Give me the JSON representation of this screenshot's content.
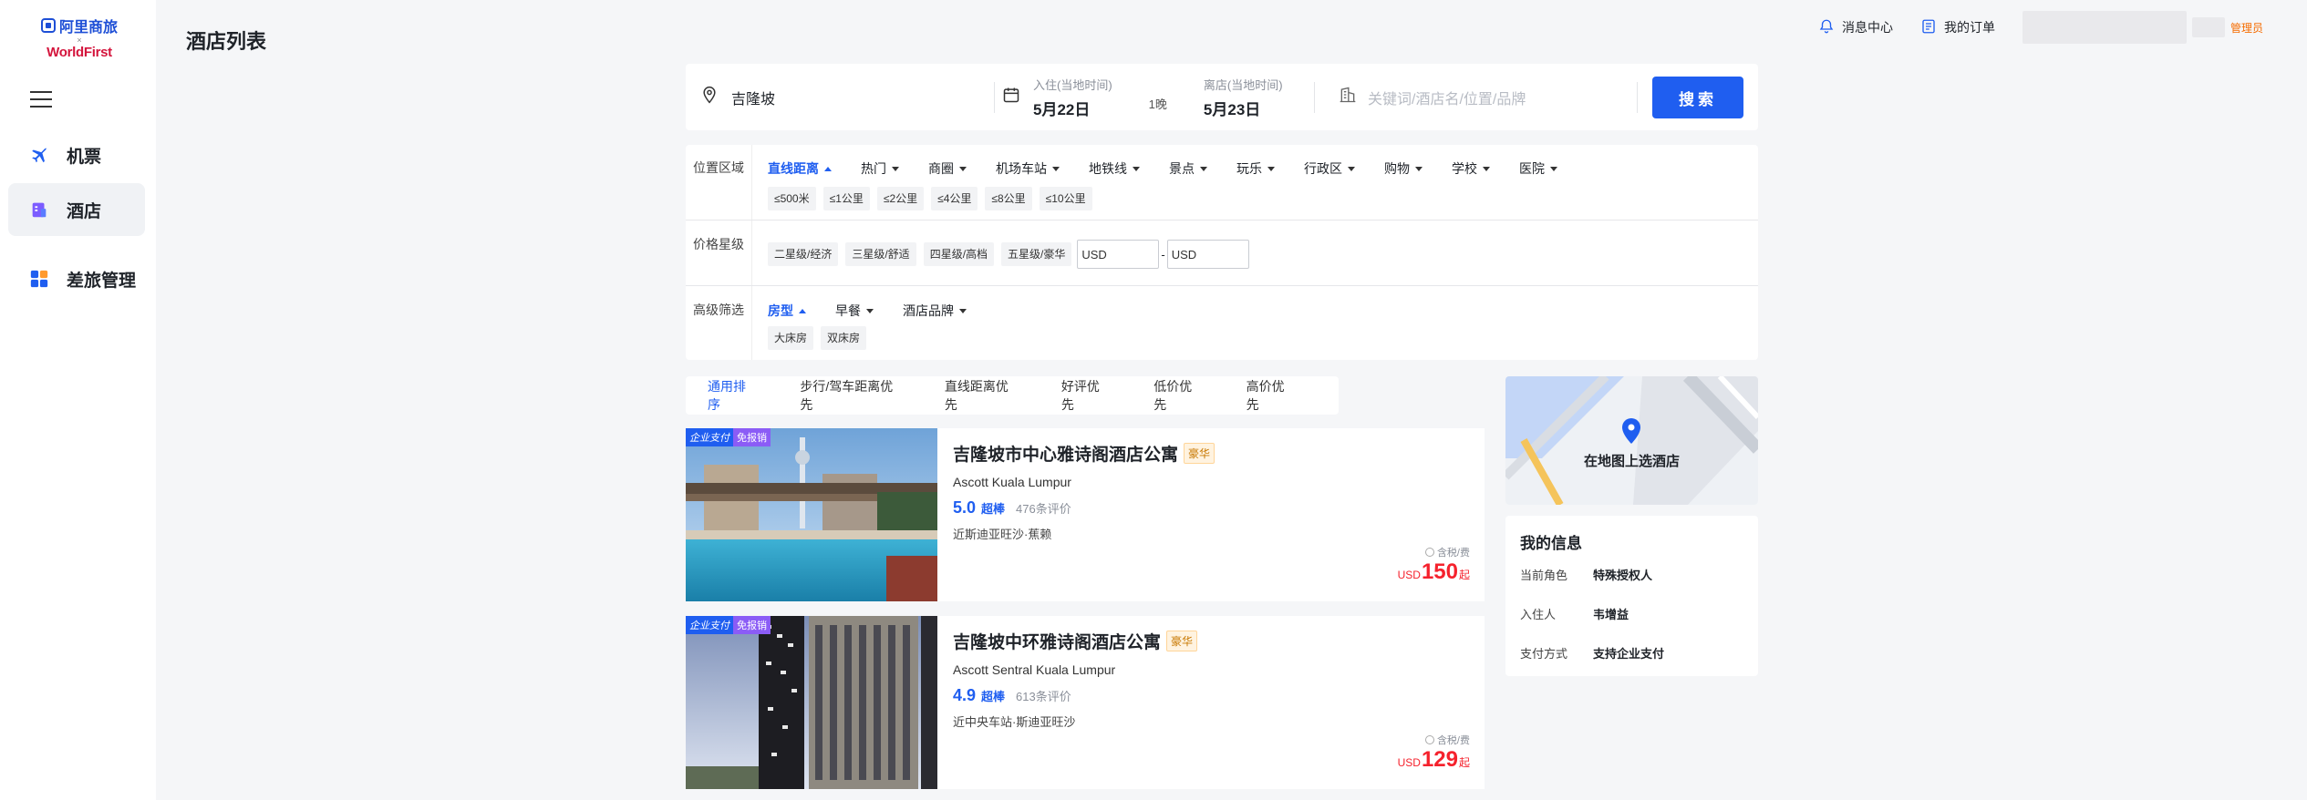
{
  "logo": {
    "top": "阿里商旅",
    "x": "×",
    "bottom": "WorldFirst"
  },
  "sidebar": {
    "items": [
      {
        "label": "机票",
        "icon": "airplane-icon"
      },
      {
        "label": "酒店",
        "icon": "hotel-icon"
      },
      {
        "label": "差旅管理",
        "icon": "apps-grid-icon"
      }
    ]
  },
  "page": {
    "title": "酒店列表"
  },
  "topbar": {
    "messages": "消息中心",
    "orders": "我的订单",
    "role_tag": "管理员"
  },
  "search": {
    "city": "吉隆坡",
    "checkin_label": "入住(当地时间)",
    "checkin_value": "5月22日",
    "nights": "1晚",
    "checkout_label": "离店(当地时间)",
    "checkout_value": "5月23日",
    "keyword_placeholder": "关键词/酒店名/位置/品牌",
    "button": "搜索"
  },
  "filters": {
    "location": {
      "label": "位置区域",
      "tabs": [
        "直线距离",
        "热门",
        "商圈",
        "机场车站",
        "地铁线",
        "景点",
        "玩乐",
        "行政区",
        "购物",
        "学校",
        "医院"
      ],
      "chips": [
        "≤500米",
        "≤1公里",
        "≤2公里",
        "≤4公里",
        "≤8公里",
        "≤10公里"
      ]
    },
    "price": {
      "label": "价格星级",
      "chips": [
        "二星级/经济",
        "三星级/舒适",
        "四星级/高档",
        "五星级/豪华"
      ],
      "min": "USD",
      "max": "USD",
      "dash": "-"
    },
    "advanced": {
      "label": "高级筛选",
      "tabs": [
        "房型",
        "早餐",
        "酒店品牌"
      ],
      "chips": [
        "大床房",
        "双床房"
      ]
    }
  },
  "sort": {
    "options": [
      "通用排序",
      "步行/驾车距离优先",
      "直线距离优先",
      "好评优先",
      "低价优先",
      "高价优先"
    ]
  },
  "hotels": [
    {
      "badge_a": "企业支付",
      "badge_b": "免报销",
      "name": "吉隆坡市中心雅诗阁酒店公寓",
      "tag": "豪华",
      "name_en": "Ascott Kuala Lumpur",
      "score": "5.0",
      "score_word": "超棒",
      "reviews": "476条评价",
      "location": "近斯迪亚旺沙·蕉赖",
      "tax_note": "含税/费",
      "currency": "USD",
      "price": "150",
      "price_suffix": "起"
    },
    {
      "badge_a": "企业支付",
      "badge_b": "免报销",
      "name": "吉隆坡中环雅诗阁酒店公寓",
      "tag": "豪华",
      "name_en": "Ascott Sentral Kuala Lumpur",
      "score": "4.9",
      "score_word": "超棒",
      "reviews": "613条评价",
      "location": "近中央车站·斯迪亚旺沙",
      "tax_note": "含税/费",
      "currency": "USD",
      "price": "129",
      "price_suffix": "起"
    }
  ],
  "map": {
    "label": "在地图上选酒店"
  },
  "my_info": {
    "title": "我的信息",
    "rows": [
      {
        "key": "当前角色",
        "value": "特殊授权人"
      },
      {
        "key": "入住人",
        "value": "韦增益"
      },
      {
        "key": "支付方式",
        "value": "支持企业支付"
      }
    ]
  },
  "colors": {
    "primary": "#1f5ef0",
    "price": "#f5222d",
    "background": "#f5f6f8"
  }
}
